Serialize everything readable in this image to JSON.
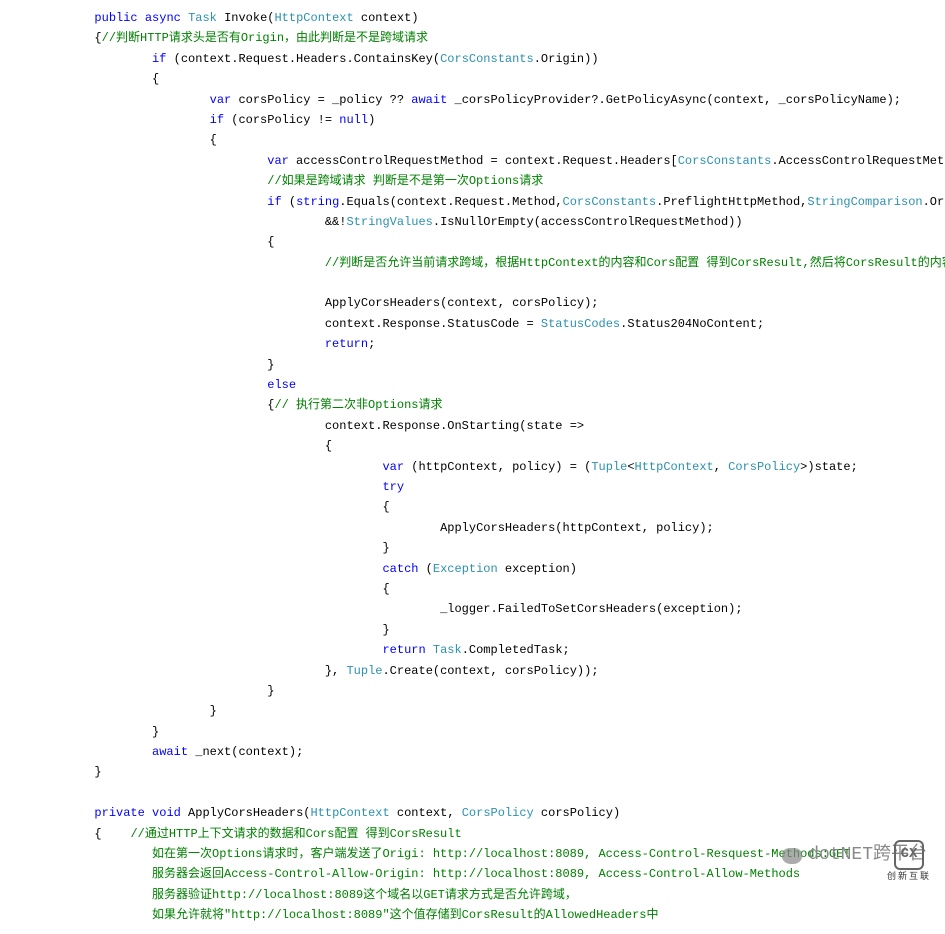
{
  "lines": [
    {
      "indent": 3,
      "tokens": [
        {
          "t": "public",
          "c": "kw"
        },
        {
          "t": " ",
          "c": ""
        },
        {
          "t": "async",
          "c": "kw"
        },
        {
          "t": " ",
          "c": ""
        },
        {
          "t": "Task",
          "c": "type"
        },
        {
          "t": " Invoke(",
          "c": ""
        },
        {
          "t": "HttpContext",
          "c": "type"
        },
        {
          "t": " context)",
          "c": ""
        }
      ]
    },
    {
      "indent": 3,
      "tokens": [
        {
          "t": "{",
          "c": ""
        },
        {
          "t": "//判断HTTP请求头是否有Origin，由此判断是不是跨域请求",
          "c": "comment-green"
        }
      ]
    },
    {
      "indent": 5,
      "tokens": [
        {
          "t": "if",
          "c": "kw"
        },
        {
          "t": " (context.Request.Headers.ContainsKey(",
          "c": ""
        },
        {
          "t": "CorsConstants",
          "c": "type"
        },
        {
          "t": ".Origin))",
          "c": ""
        }
      ]
    },
    {
      "indent": 5,
      "tokens": [
        {
          "t": "{",
          "c": ""
        }
      ]
    },
    {
      "indent": 7,
      "tokens": [
        {
          "t": "var",
          "c": "kw"
        },
        {
          "t": " corsPolicy = _policy ?? ",
          "c": ""
        },
        {
          "t": "await",
          "c": "kw"
        },
        {
          "t": " _corsPolicyProvider?.GetPolicyAsync(context, _corsPolicyName);",
          "c": ""
        }
      ]
    },
    {
      "indent": 7,
      "tokens": [
        {
          "t": "if",
          "c": "kw"
        },
        {
          "t": " (corsPolicy != ",
          "c": ""
        },
        {
          "t": "null",
          "c": "kw"
        },
        {
          "t": ")",
          "c": ""
        }
      ]
    },
    {
      "indent": 7,
      "tokens": [
        {
          "t": "{",
          "c": ""
        }
      ]
    },
    {
      "indent": 9,
      "tokens": [
        {
          "t": "var",
          "c": "kw"
        },
        {
          "t": " accessControlRequestMethod = context.Request.Headers[",
          "c": ""
        },
        {
          "t": "CorsConstants",
          "c": "type"
        },
        {
          "t": ".AccessControlRequestMethod];",
          "c": ""
        }
      ]
    },
    {
      "indent": 9,
      "tokens": [
        {
          "t": "//如果是跨域请求 判断是不是第一次Options请求",
          "c": "comment-green"
        }
      ]
    },
    {
      "indent": 9,
      "tokens": [
        {
          "t": "if",
          "c": "kw"
        },
        {
          "t": " (",
          "c": ""
        },
        {
          "t": "string",
          "c": "kw"
        },
        {
          "t": ".Equals(context.Request.Method,",
          "c": ""
        },
        {
          "t": "CorsConstants",
          "c": "type"
        },
        {
          "t": ".PreflightHttpMethod,",
          "c": ""
        },
        {
          "t": "StringComparison",
          "c": "type"
        },
        {
          "t": ".OrdinalIgnoreCase)",
          "c": ""
        }
      ]
    },
    {
      "indent": 11,
      "tokens": [
        {
          "t": "&&!",
          "c": ""
        },
        {
          "t": "StringValues",
          "c": "type"
        },
        {
          "t": ".IsNullOrEmpty(accessControlRequestMethod))",
          "c": ""
        }
      ]
    },
    {
      "indent": 9,
      "tokens": [
        {
          "t": "{",
          "c": ""
        }
      ]
    },
    {
      "indent": 11,
      "tokens": [
        {
          "t": "//判断是否允许当前请求跨域，根据HttpContext的内容和Cors配置 得到CorsResult,然后将CorsResult的内容添加到请求头中(看下面详细解",
          "c": "comment-green"
        }
      ]
    },
    {
      "indent": 0,
      "tokens": [
        {
          "t": " ",
          "c": ""
        }
      ]
    },
    {
      "indent": 11,
      "tokens": [
        {
          "t": "ApplyCorsHeaders(context, corsPolicy);",
          "c": ""
        }
      ]
    },
    {
      "indent": 11,
      "tokens": [
        {
          "t": "context.Response.StatusCode = ",
          "c": ""
        },
        {
          "t": "StatusCodes",
          "c": "type"
        },
        {
          "t": ".Status204NoContent;",
          "c": ""
        }
      ]
    },
    {
      "indent": 11,
      "tokens": [
        {
          "t": "return",
          "c": "kw"
        },
        {
          "t": ";",
          "c": ""
        }
      ]
    },
    {
      "indent": 9,
      "tokens": [
        {
          "t": "}",
          "c": ""
        }
      ]
    },
    {
      "indent": 9,
      "tokens": [
        {
          "t": "else",
          "c": "kw"
        }
      ]
    },
    {
      "indent": 9,
      "tokens": [
        {
          "t": "{",
          "c": ""
        },
        {
          "t": "// 执行第二次非Options请求",
          "c": "comment-green"
        }
      ]
    },
    {
      "indent": 11,
      "tokens": [
        {
          "t": "context.Response.OnStarting(state =>",
          "c": ""
        }
      ]
    },
    {
      "indent": 11,
      "tokens": [
        {
          "t": "{",
          "c": ""
        }
      ]
    },
    {
      "indent": 13,
      "tokens": [
        {
          "t": "var",
          "c": "kw"
        },
        {
          "t": " (httpContext, policy) = (",
          "c": ""
        },
        {
          "t": "Tuple",
          "c": "type"
        },
        {
          "t": "<",
          "c": ""
        },
        {
          "t": "HttpContext",
          "c": "type"
        },
        {
          "t": ", ",
          "c": ""
        },
        {
          "t": "CorsPolicy",
          "c": "type"
        },
        {
          "t": ">)state;",
          "c": ""
        }
      ]
    },
    {
      "indent": 13,
      "tokens": [
        {
          "t": "try",
          "c": "kw"
        }
      ]
    },
    {
      "indent": 13,
      "tokens": [
        {
          "t": "{",
          "c": ""
        }
      ]
    },
    {
      "indent": 15,
      "tokens": [
        {
          "t": "ApplyCorsHeaders(httpContext, policy);",
          "c": ""
        }
      ]
    },
    {
      "indent": 13,
      "tokens": [
        {
          "t": "}",
          "c": ""
        }
      ]
    },
    {
      "indent": 13,
      "tokens": [
        {
          "t": "catch",
          "c": "kw"
        },
        {
          "t": " (",
          "c": ""
        },
        {
          "t": "Exception",
          "c": "type"
        },
        {
          "t": " exception)",
          "c": ""
        }
      ]
    },
    {
      "indent": 13,
      "tokens": [
        {
          "t": "{",
          "c": ""
        }
      ]
    },
    {
      "indent": 15,
      "tokens": [
        {
          "t": "_logger.FailedToSetCorsHeaders(exception);",
          "c": ""
        }
      ]
    },
    {
      "indent": 13,
      "tokens": [
        {
          "t": "}",
          "c": ""
        }
      ]
    },
    {
      "indent": 13,
      "tokens": [
        {
          "t": "return",
          "c": "kw"
        },
        {
          "t": " ",
          "c": ""
        },
        {
          "t": "Task",
          "c": "type"
        },
        {
          "t": ".CompletedTask;",
          "c": ""
        }
      ]
    },
    {
      "indent": 11,
      "tokens": [
        {
          "t": "}, ",
          "c": ""
        },
        {
          "t": "Tuple",
          "c": "type"
        },
        {
          "t": ".Create(context, corsPolicy));",
          "c": ""
        }
      ]
    },
    {
      "indent": 9,
      "tokens": [
        {
          "t": "}",
          "c": ""
        }
      ]
    },
    {
      "indent": 7,
      "tokens": [
        {
          "t": "}",
          "c": ""
        }
      ]
    },
    {
      "indent": 5,
      "tokens": [
        {
          "t": "}",
          "c": ""
        }
      ]
    },
    {
      "indent": 5,
      "tokens": [
        {
          "t": "await",
          "c": "kw"
        },
        {
          "t": " _next(context);",
          "c": ""
        }
      ]
    },
    {
      "indent": 3,
      "tokens": [
        {
          "t": "}",
          "c": ""
        }
      ]
    },
    {
      "indent": 0,
      "tokens": [
        {
          "t": " ",
          "c": ""
        }
      ]
    },
    {
      "indent": 3,
      "tokens": [
        {
          "t": "private",
          "c": "kw"
        },
        {
          "t": " ",
          "c": ""
        },
        {
          "t": "void",
          "c": "kw"
        },
        {
          "t": " ApplyCorsHeaders(",
          "c": ""
        },
        {
          "t": "HttpContext",
          "c": "type"
        },
        {
          "t": " context, ",
          "c": ""
        },
        {
          "t": "CorsPolicy",
          "c": "type"
        },
        {
          "t": " corsPolicy)",
          "c": ""
        }
      ]
    },
    {
      "indent": 3,
      "tokens": [
        {
          "t": "{    ",
          "c": ""
        },
        {
          "t": "//通过HTTP上下文请求的数据和Cors配置 得到CorsResult",
          "c": "comment-green"
        }
      ]
    },
    {
      "indent": 5,
      "tokens": [
        {
          "t": "如在第一次Options请求时，客户端发送了Origi: http://localhost:8089, Access-Control-Resquest-Methods:GET",
          "c": "comment-green"
        }
      ]
    },
    {
      "indent": 5,
      "tokens": [
        {
          "t": "服务器会返回Access-Control-Allow-Origin: http://localhost:8089, Access-Control-Allow-Methods",
          "c": "comment-green"
        }
      ]
    },
    {
      "indent": 5,
      "tokens": [
        {
          "t": "服务器验证http://localhost:8089这个域名以GET请求方式是否允许跨域，",
          "c": "comment-green"
        }
      ]
    },
    {
      "indent": 5,
      "tokens": [
        {
          "t": "如果允许就将\"http://localhost:8089\"这个值存储到CorsResult的AllowedHeaders中",
          "c": "comment-green"
        }
      ]
    }
  ],
  "watermark": "dotNET跨平台",
  "logoText": "创新互联",
  "logoInitials": "CX"
}
